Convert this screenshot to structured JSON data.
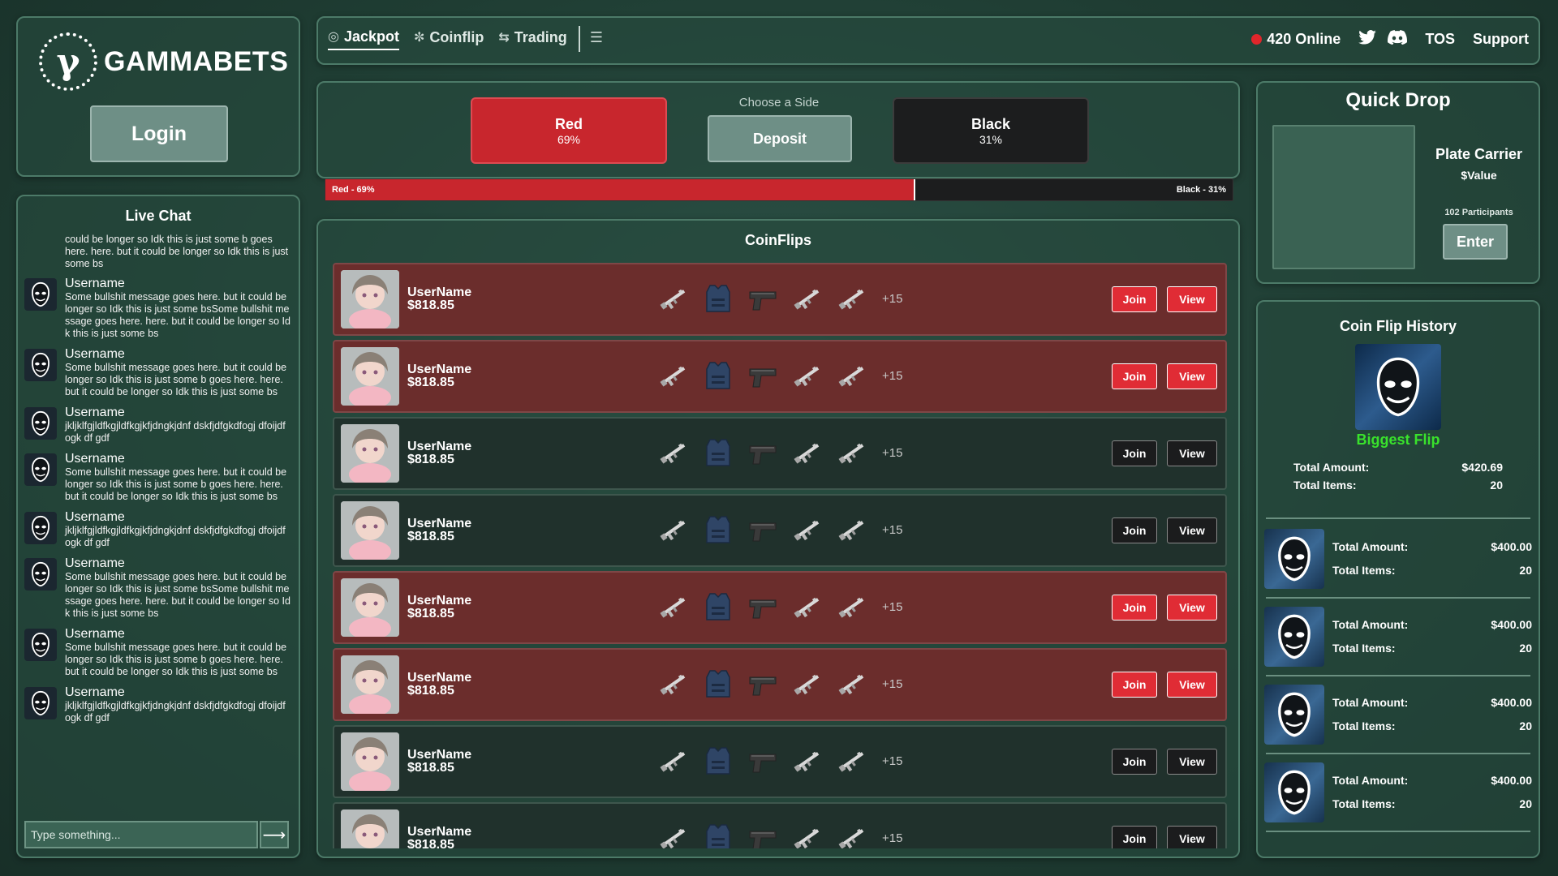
{
  "brand": {
    "name": "GAMMABETS",
    "logo_glyph": "γ"
  },
  "login": {
    "label": "Login"
  },
  "nav": {
    "tabs": [
      {
        "label": "Jackpot",
        "icon": "target-icon",
        "active": true
      },
      {
        "label": "Coinflip",
        "icon": "coin-icon",
        "active": false
      },
      {
        "label": "Trading",
        "icon": "trade-icon",
        "active": false
      }
    ],
    "extra_icon": "coins-stack-icon",
    "online_count": "420 Online",
    "links": {
      "tos": "TOS",
      "support": "Support"
    },
    "social": [
      "twitter-icon",
      "discord-icon"
    ]
  },
  "chat": {
    "title": "Live Chat",
    "fragment": "could be longer so Idk this is just some b goes here. here. but it could be longer so Idk this is just some bs",
    "messages": [
      {
        "user": "Username",
        "text": "Some bullshit message goes here. but it could be longer so Idk this is just some bsSome bullshit message goes here. here. but it could be longer so Idk this is just some bs"
      },
      {
        "user": "Username",
        "text": "Some bullshit message goes here. but it could be longer so Idk this is just some b goes here. here. but it could be longer so Idk this is just some bs"
      },
      {
        "user": "Username",
        "text": "jkljklfgjldfkgjldfkgjkfjdngkjdnf dskfjdfgkdfogj dfoijdfogk df gdf"
      },
      {
        "user": "Username",
        "text": "Some bullshit message goes here. but it could be longer so Idk this is just some b goes here. here. but it could be longer so Idk this is just some bs"
      },
      {
        "user": "Username",
        "text": "jkljklfgjldfkgjldfkgjkfjdngkjdnf dskfjdfgkdfogj dfoijdfogk df gdf"
      },
      {
        "user": "Username",
        "text": "Some bullshit message goes here. but it could be longer so Idk this is just some bsSome bullshit message goes here. here. but it could be longer so Idk this is just some bs"
      },
      {
        "user": "Username",
        "text": "Some bullshit message goes here. but it could be longer so Idk this is just some b goes here. here. but it could be longer so Idk this is just some bs"
      },
      {
        "user": "Username",
        "text": "jkljklfgjldfkgjldfkgjkfjdngkjdnf dskfjdfgkdfogj dfoijdfogk df gdf"
      }
    ],
    "input_placeholder": "Type something...",
    "send_icon": "arrow-right-icon"
  },
  "jackpot": {
    "red": {
      "label": "Red",
      "pct": "69%"
    },
    "black": {
      "label": "Black",
      "pct": "31%"
    },
    "choose_label": "Choose a Side",
    "deposit_label": "Deposit",
    "progress": {
      "red_label": "Red - 69%",
      "black_label": "Black - 31%",
      "red_fraction": 0.65
    }
  },
  "coinflips": {
    "title": "CoinFlips",
    "rows": [
      {
        "user": "UserName",
        "amount": "$818.85",
        "side": "red",
        "extra": "+15",
        "join": "Join",
        "view": "View"
      },
      {
        "user": "UserName",
        "amount": "$818.85",
        "side": "red",
        "extra": "+15",
        "join": "Join",
        "view": "View"
      },
      {
        "user": "UserName",
        "amount": "$818.85",
        "side": "dark",
        "extra": "+15",
        "join": "Join",
        "view": "View"
      },
      {
        "user": "UserName",
        "amount": "$818.85",
        "side": "dark",
        "extra": "+15",
        "join": "Join",
        "view": "View"
      },
      {
        "user": "UserName",
        "amount": "$818.85",
        "side": "red",
        "extra": "+15",
        "join": "Join",
        "view": "View"
      },
      {
        "user": "UserName",
        "amount": "$818.85",
        "side": "red",
        "extra": "+15",
        "join": "Join",
        "view": "View"
      },
      {
        "user": "UserName",
        "amount": "$818.85",
        "side": "dark",
        "extra": "+15",
        "join": "Join",
        "view": "View"
      },
      {
        "user": "UserName",
        "amount": "$818.85",
        "side": "dark",
        "extra": "+15",
        "join": "Join",
        "view": "View"
      }
    ],
    "item_icons": [
      "rifle-icon",
      "vest-icon",
      "pistol-icon",
      "rifle-icon",
      "rifle-icon"
    ]
  },
  "quick_drop": {
    "title": "Quick Drop",
    "item_name": "Plate Carrier",
    "value": "$Value",
    "participants": "102 Participants",
    "enter_label": "Enter"
  },
  "history": {
    "title": "Coin Flip History",
    "biggest_label": "Biggest Flip",
    "biggest": {
      "amount_label": "Total Amount:",
      "amount": "$420.69",
      "items_label": "Total Items:",
      "items": "20"
    },
    "entries": [
      {
        "amount_label": "Total Amount:",
        "amount": "$400.00",
        "items_label": "Total Items:",
        "items": "20"
      },
      {
        "amount_label": "Total Amount:",
        "amount": "$400.00",
        "items_label": "Total Items:",
        "items": "20"
      },
      {
        "amount_label": "Total Amount:",
        "amount": "$400.00",
        "items_label": "Total Items:",
        "items": "20"
      },
      {
        "amount_label": "Total Amount:",
        "amount": "$400.00",
        "items_label": "Total Items:",
        "items": "20"
      }
    ]
  },
  "colors": {
    "red": "#c8262d",
    "black": "#1c1d1e",
    "panel_border": "#4c7a68",
    "accent_green": "#39e22c",
    "online_dot": "#e0262b"
  }
}
